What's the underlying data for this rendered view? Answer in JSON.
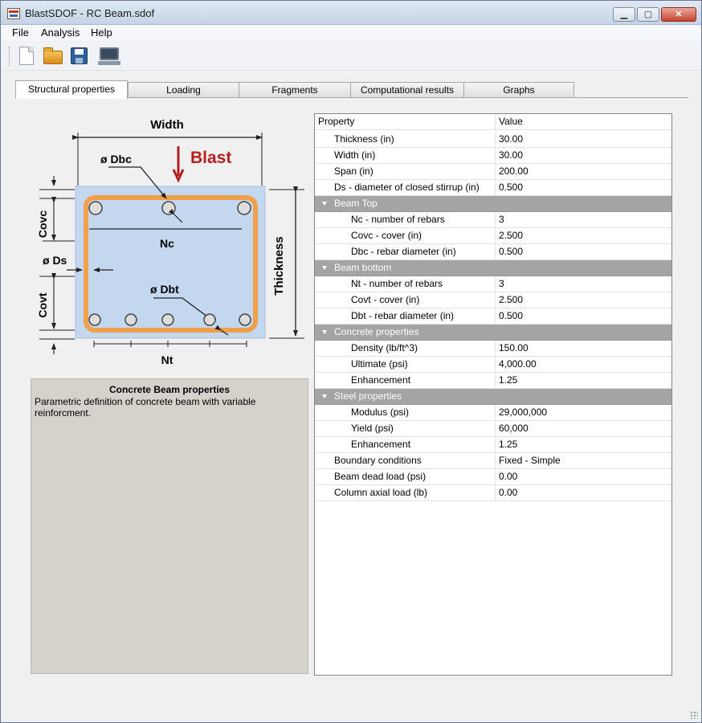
{
  "window": {
    "title": "BlastSDOF - RC Beam.sdof"
  },
  "menu": {
    "file": "File",
    "analysis": "Analysis",
    "help": "Help"
  },
  "toolbar": {
    "new_icon": "new-file-icon",
    "open_icon": "open-folder-icon",
    "save_icon": "save-disk-icon",
    "compute_icon": "computer-icon"
  },
  "tabs": [
    "Structural properties",
    "Loading",
    "Fragments",
    "Computational results",
    "Graphs"
  ],
  "diagram": {
    "width": "Width",
    "blast": "Blast",
    "dbc": "ø Dbc",
    "covc": "Covc",
    "nc": "Nc",
    "ds": "ø Ds",
    "dbt": "ø Dbt",
    "covt": "Covt",
    "nt": "Nt",
    "thickness": "Thickness"
  },
  "description": {
    "title": "Concrete Beam properties",
    "text": "Parametric definition of concrete beam with variable reinforcment."
  },
  "grid": {
    "header": {
      "property": "Property",
      "value": "Value"
    },
    "rows": [
      {
        "name": "Thickness (in)",
        "value": "30.00"
      },
      {
        "name": "Width (in)",
        "value": "30.00"
      },
      {
        "name": "Span (in)",
        "value": "200.00"
      },
      {
        "name": "Ds - diameter of closed stirrup (in)",
        "value": "0.500"
      },
      {
        "name": "Beam Top"
      },
      {
        "name": "Nc - number of rebars",
        "value": "3"
      },
      {
        "name": "Covc - cover (in)",
        "value": "2.500"
      },
      {
        "name": "Dbc - rebar diameter (in)",
        "value": "0.500"
      },
      {
        "name": "Beam bottom"
      },
      {
        "name": "Nt - number of rebars",
        "value": "3"
      },
      {
        "name": "Covt - cover (in)",
        "value": "2.500"
      },
      {
        "name": "Dbt - rebar diameter (in)",
        "value": "0.500"
      },
      {
        "name": "Concrete properties"
      },
      {
        "name": "Density (lb/ft^3)",
        "value": "150.00"
      },
      {
        "name": "Ultimate (psi)",
        "value": "4,000.00"
      },
      {
        "name": "Enhancement",
        "value": "1.25"
      },
      {
        "name": "Steel properties"
      },
      {
        "name": "Modulus (psi)",
        "value": "29,000,000"
      },
      {
        "name": "Yield (psi)",
        "value": "60,000"
      },
      {
        "name": "Enhancement",
        "value": "1.25"
      },
      {
        "name": "Boundary conditions",
        "value": "Fixed - Simple"
      },
      {
        "name": "Beam dead load (psi)",
        "value": "0.00"
      },
      {
        "name": "Column axial load (lb)",
        "value": "0.00"
      }
    ]
  }
}
